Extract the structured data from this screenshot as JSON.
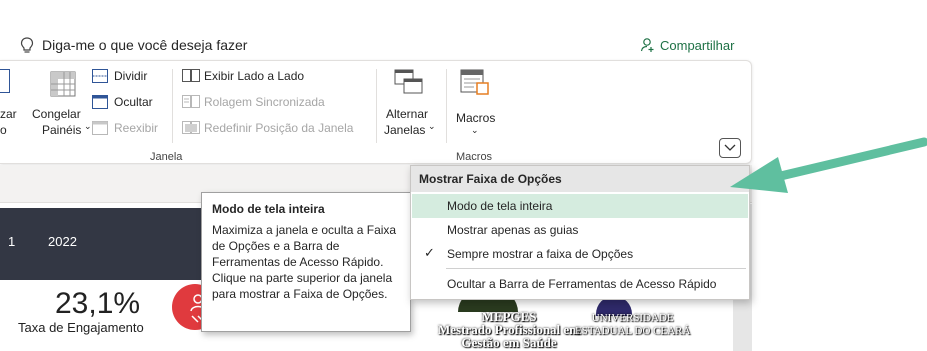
{
  "tellme": {
    "placeholder": "Diga-me o que você deseja fazer",
    "share_label": "Compartilhar"
  },
  "ribbon": {
    "cut_left_1": "zar",
    "cut_left_2": "o",
    "congelar_1": "Congelar",
    "congelar_2": "Painéis",
    "dividir": "Dividir",
    "ocultar": "Ocultar",
    "reexibir": "Reexibir",
    "exibir_lado": "Exibir Lado a Lado",
    "rolagem": "Rolagem Sincronizada",
    "redefinir": "Redefinir Posição da Janela",
    "alternar_1": "Alternar",
    "alternar_2": "Janelas",
    "macros": "Macros",
    "group_janela": "Janela",
    "group_macros": "Macros"
  },
  "menu": {
    "header": "Mostrar Faixa de Opções",
    "items": [
      {
        "label": "Modo de tela inteira",
        "highlighted": true,
        "checked": false
      },
      {
        "label": "Mostrar apenas as guias",
        "highlighted": false,
        "checked": false
      },
      {
        "label": "Sempre mostrar a faixa de Opções",
        "highlighted": false,
        "checked": true
      },
      {
        "label": "Ocultar a Barra de Ferramentas de Acesso Rápido",
        "highlighted": false,
        "checked": false
      }
    ]
  },
  "tooltip": {
    "title": "Modo de tela inteira",
    "body": "Maximiza a janela e oculta a Faixa de Opções e a Barra de Ferramentas de Acesso Rápido. Clique na parte superior da janela para mostrar a Faixa de Opções."
  },
  "sheet": {
    "year_a": "1",
    "year_b": "2022",
    "engagement_value": "23,1%",
    "engagement_label": "Taxa de Engajamento",
    "mepges_1": "MEPGES",
    "mepges_2": "Mestrado Profissional em",
    "mepges_3": "Gestão em Saúde",
    "uece_1": "UNIVERSIDADE",
    "uece_2": "ESTADUAL DO CEARÁ"
  },
  "colors": {
    "accent_green": "#1e7145",
    "highlight": "#d5ecdf",
    "arrow": "#5fbf9f",
    "dark_band": "#333744",
    "engagement_red": "#e03a3e"
  }
}
